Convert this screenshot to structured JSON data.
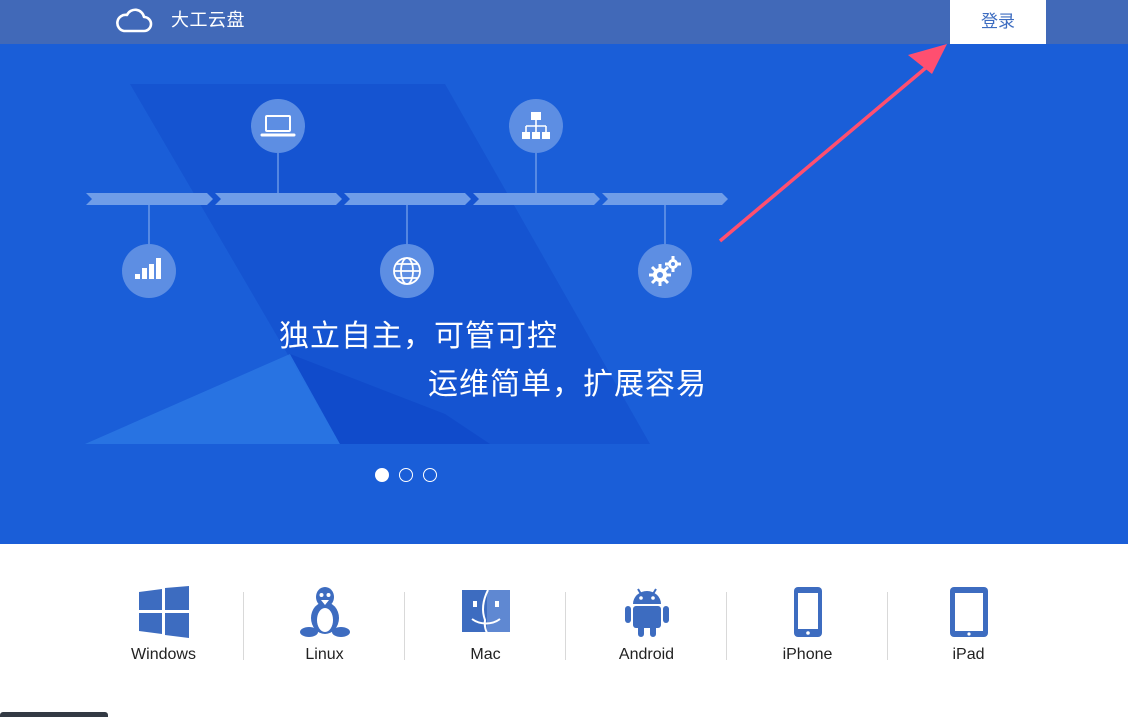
{
  "header": {
    "brand": "大工云盘",
    "login_label": "登录",
    "logo_icon": "cloud-icon",
    "bg_color": "#4169b8"
  },
  "hero": {
    "bg_color": "#1a5ed8",
    "slogan_line1": "独立自主，可管可控",
    "slogan_line2": "运维简单，扩展容易",
    "timeline_icons": [
      "laptop-icon",
      "sitemap-icon",
      "bar-chart-icon",
      "globe-icon",
      "gears-icon"
    ],
    "carousel": {
      "count": 3,
      "active": 1
    }
  },
  "platforms": [
    {
      "label": "Windows",
      "icon": "windows-icon"
    },
    {
      "label": "Linux",
      "icon": "linux-icon"
    },
    {
      "label": "Mac",
      "icon": "mac-icon"
    },
    {
      "label": "Android",
      "icon": "android-icon"
    },
    {
      "label": "iPhone",
      "icon": "iphone-icon"
    },
    {
      "label": "iPad",
      "icon": "ipad-icon"
    }
  ],
  "accent_color": "#3d6cc0",
  "arrow_color": "#ff4f70"
}
